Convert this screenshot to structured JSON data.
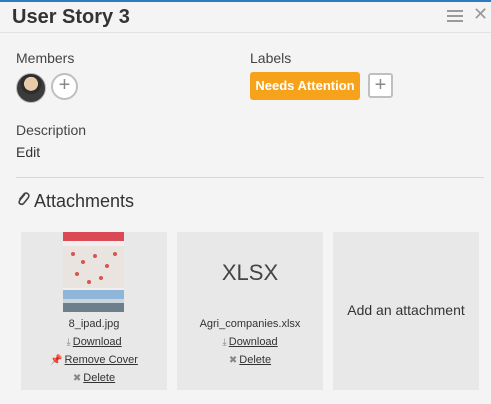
{
  "header": {
    "title": "User Story 3"
  },
  "members": {
    "label": "Members"
  },
  "labels": {
    "label": "Labels",
    "badge": "Needs Attention",
    "badge_color": "#f7a21b"
  },
  "description": {
    "label": "Description",
    "edit": "Edit"
  },
  "attachments": {
    "heading": "Attachments",
    "items": [
      {
        "file": "8_ipad.jpg",
        "download": "Download",
        "remove_cover": "Remove Cover",
        "delete": "Delete"
      },
      {
        "type": "XLSX",
        "file": "Agri_companies.xlsx",
        "download": "Download",
        "delete": "Delete"
      }
    ],
    "add": "Add an attachment"
  },
  "colors": {
    "accent": "#2f7bbf",
    "card": "#e8e8e8"
  }
}
